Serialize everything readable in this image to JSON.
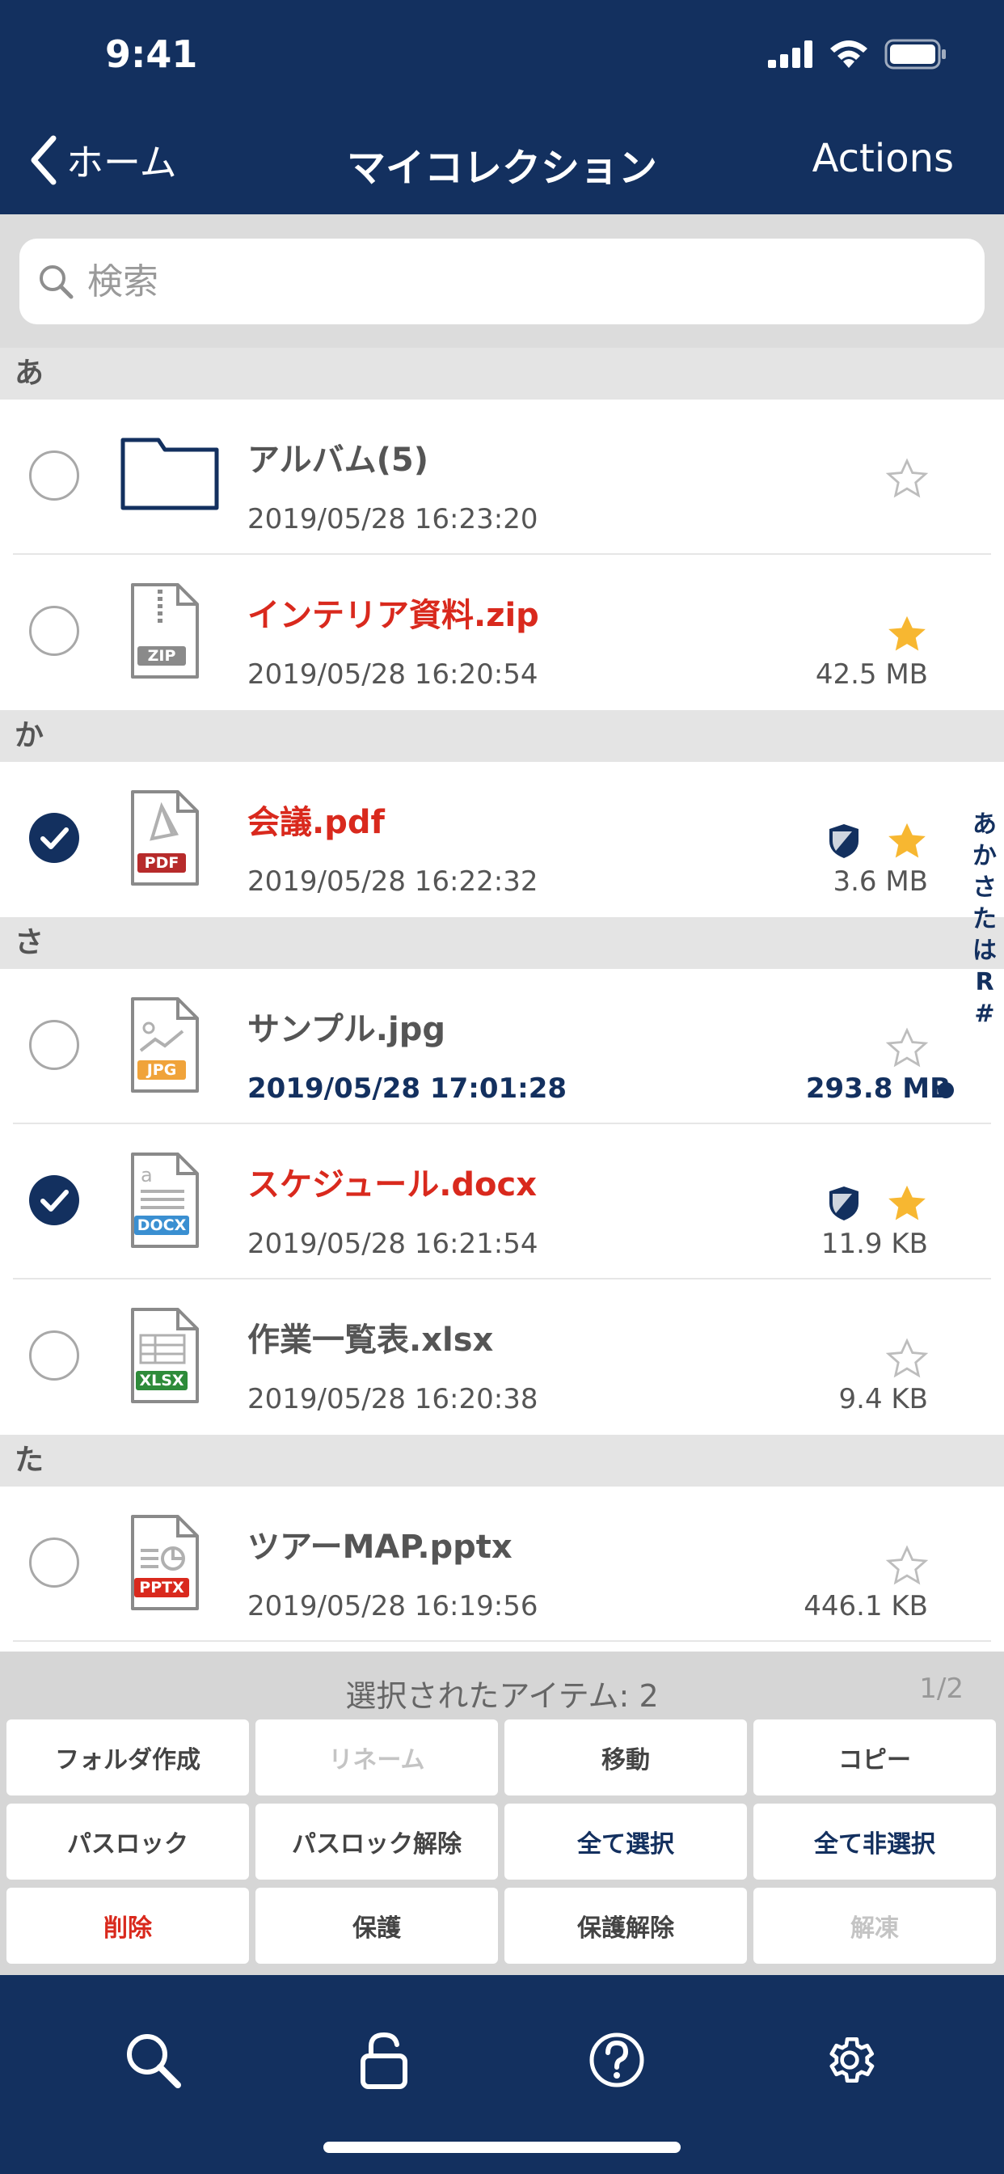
{
  "status": {
    "time": "9:41"
  },
  "nav": {
    "back_label": "ホーム",
    "title": "マイコレクション",
    "action_label": "Actions"
  },
  "search": {
    "placeholder": "検索"
  },
  "sections": [
    {
      "header": "あ",
      "items": [
        {
          "name": "アルバム(5)",
          "date": "2019/05/28 16:23:20",
          "size": "",
          "type": "folder",
          "checked": false,
          "starred": false,
          "protected": false
        },
        {
          "name": "インテリア資料.zip",
          "date": "2019/05/28 16:20:54",
          "size": "42.5 MB",
          "type": "zip",
          "checked": false,
          "starred": true,
          "protected": false
        }
      ]
    },
    {
      "header": "か",
      "items": [
        {
          "name": "会議.pdf",
          "date": "2019/05/28 16:22:32",
          "size": "3.6 MB",
          "type": "pdf",
          "checked": true,
          "starred": true,
          "protected": true
        }
      ]
    },
    {
      "header": "さ",
      "items": [
        {
          "name": "サンプル.jpg",
          "date": "2019/05/28 17:01:28",
          "size": "293.8 MB",
          "type": "jpg",
          "checked": false,
          "starred": false,
          "protected": false
        },
        {
          "name": "スケジュール.docx",
          "date": "2019/05/28 16:21:54",
          "size": "11.9 KB",
          "type": "docx",
          "checked": true,
          "starred": true,
          "protected": true
        },
        {
          "name": "作業一覧表.xlsx",
          "date": "2019/05/28 16:20:38",
          "size": "9.4 KB",
          "type": "xlsx",
          "checked": false,
          "starred": false,
          "protected": false
        }
      ]
    },
    {
      "header": "た",
      "items": [
        {
          "name": "ツアーMAP.pptx",
          "date": "2019/05/28 16:19:56",
          "size": "446.1 KB",
          "type": "pptx",
          "checked": false,
          "starred": false,
          "protected": false
        }
      ]
    }
  ],
  "file_badges": {
    "zip": "ZIP",
    "pdf": "PDF",
    "jpg": "JPG",
    "docx": "DOCX",
    "xlsx": "XLSX",
    "pptx": "PPTX"
  },
  "index": [
    "あ",
    "か",
    "さ",
    "た",
    "は",
    "R",
    "#"
  ],
  "selection": {
    "count_label": "選択されたアイテム: 2",
    "page": "1/2"
  },
  "actions": {
    "create_folder": "フォルダ作成",
    "rename": "リネーム",
    "move": "移動",
    "copy": "コピー",
    "passlock": "パスロック",
    "passlock_release": "パスロック解除",
    "select_all": "全て選択",
    "deselect_all": "全て非選択",
    "delete": "削除",
    "protect": "保護",
    "unprotect": "保護解除",
    "unzip": "解凍"
  },
  "colors": {
    "navy": "#13305f",
    "red": "#d9291d",
    "star": "#f7b731",
    "pdf": "#b72b2b",
    "jpg": "#f0a33a",
    "docx": "#3a8fd1",
    "xlsx": "#2e8b3a",
    "pptx": "#d9291d"
  }
}
